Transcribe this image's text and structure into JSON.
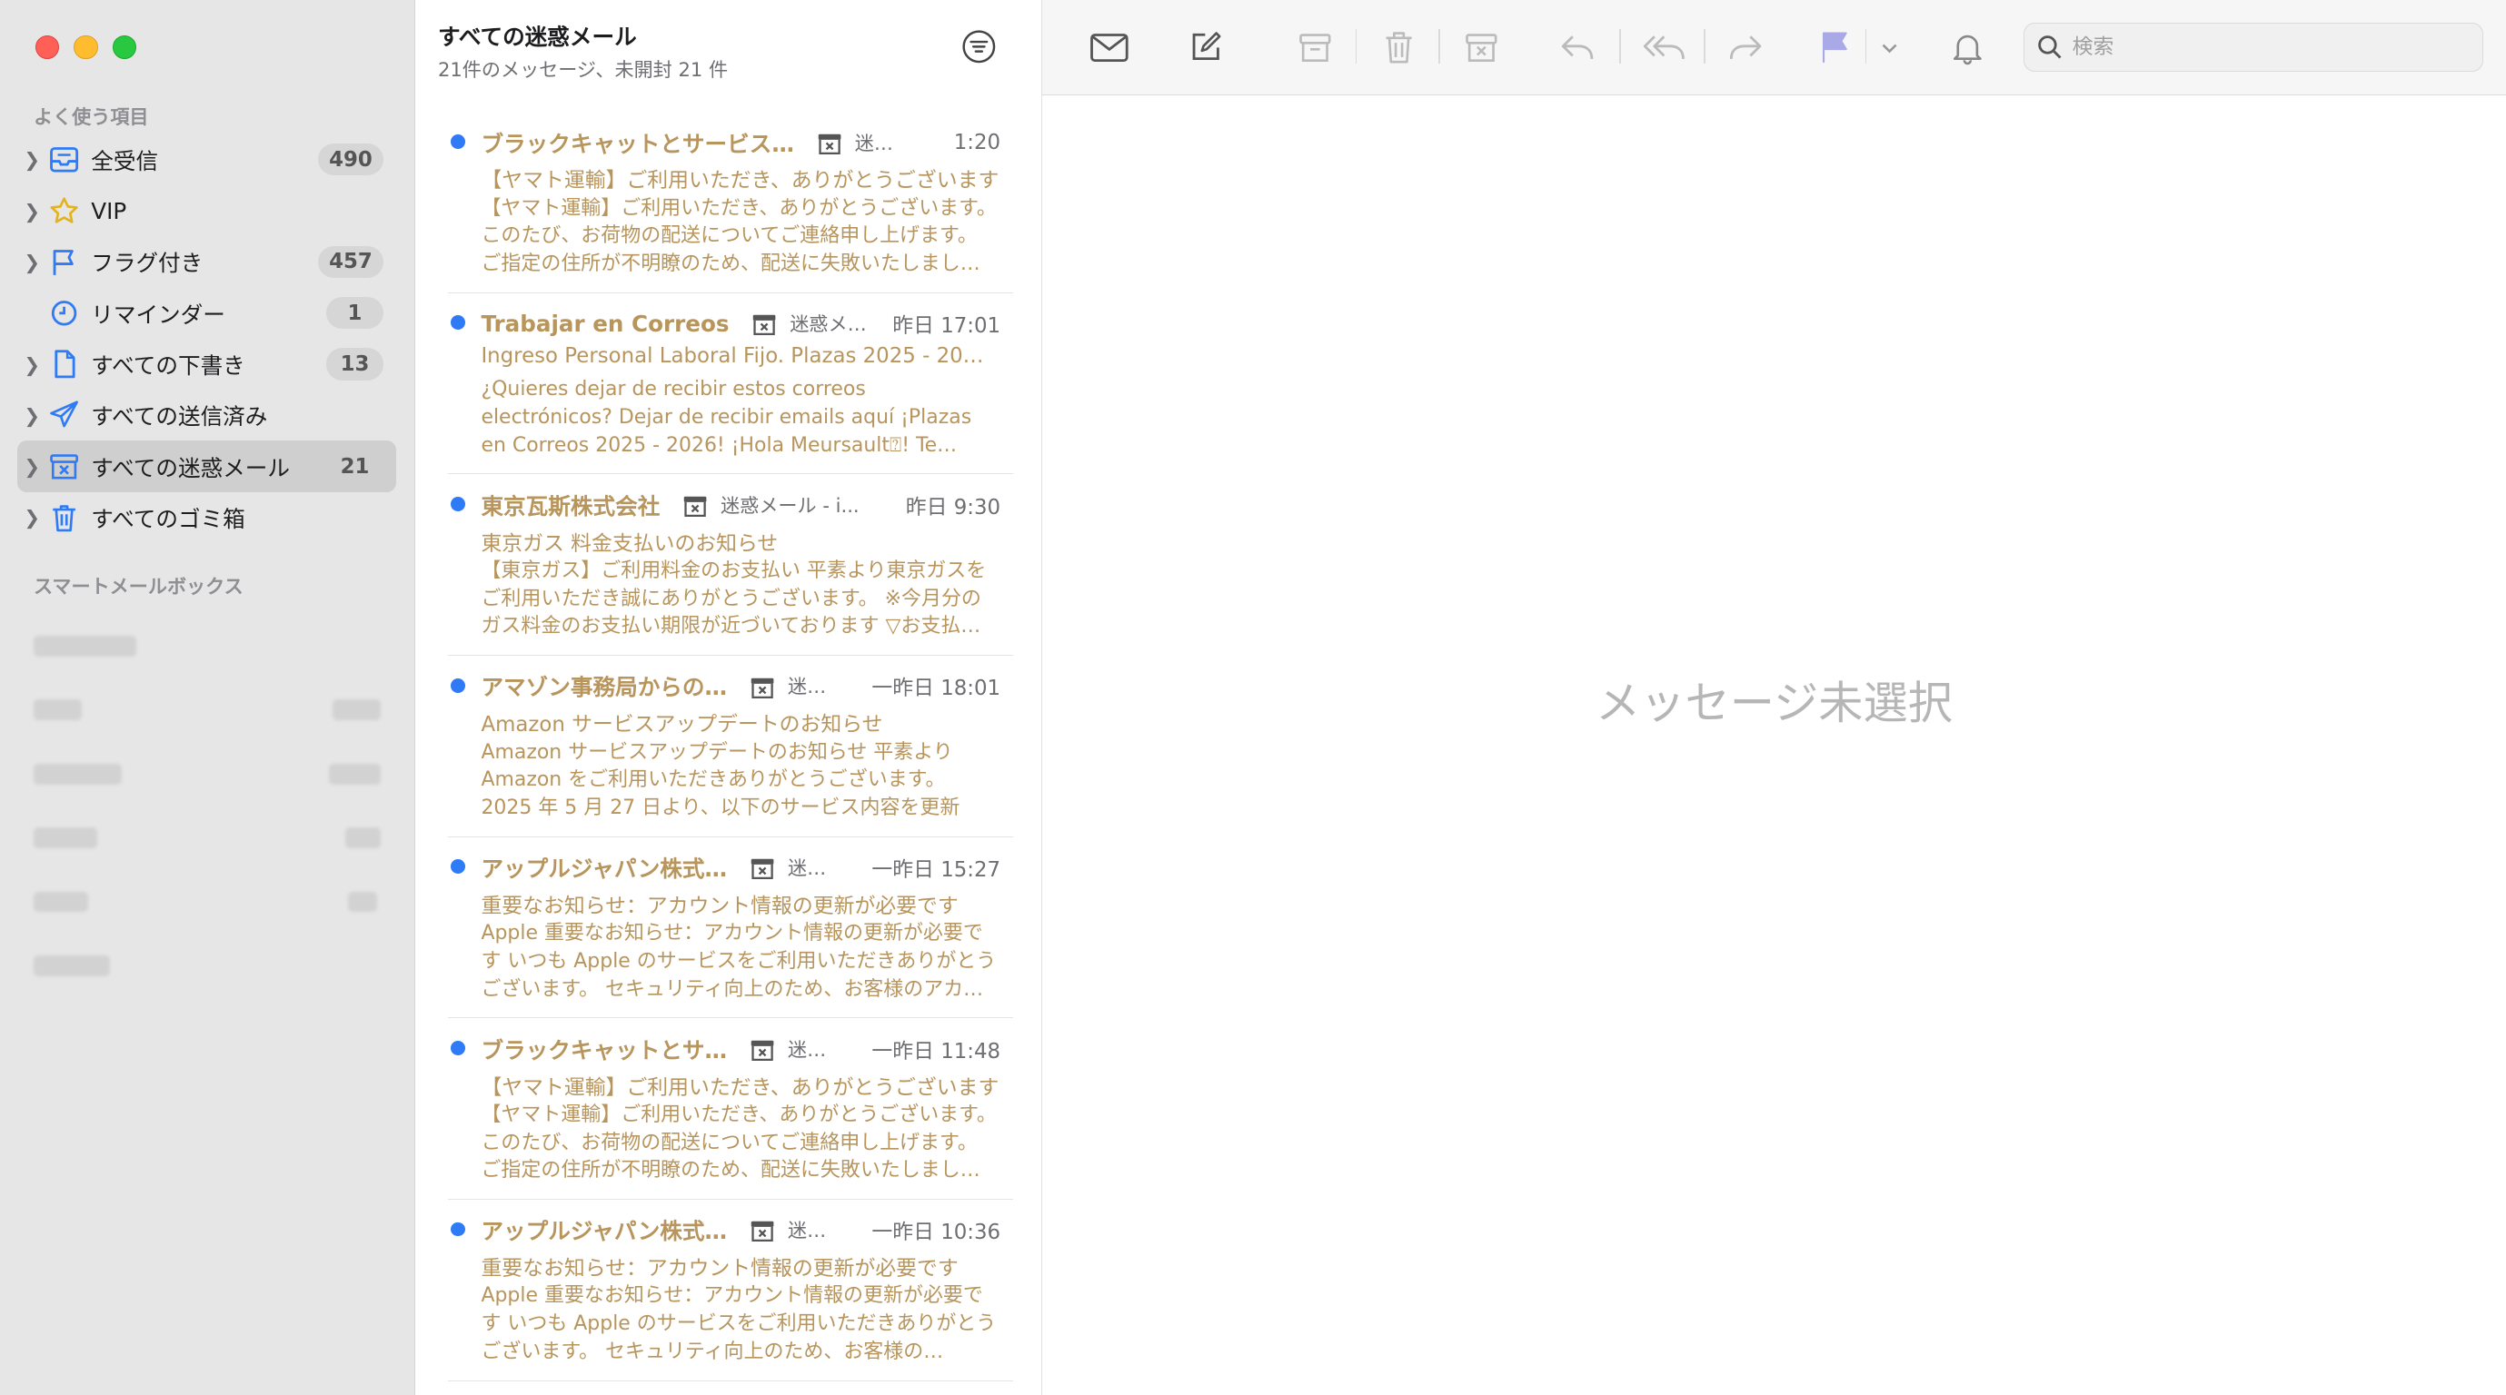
{
  "sidebar": {
    "favorites_title": "よく使う項目",
    "smart_title": "スマートメールボックス",
    "items": [
      {
        "label": "全受信",
        "count": "490"
      },
      {
        "label": "VIP",
        "count": ""
      },
      {
        "label": "フラグ付き",
        "count": "457"
      },
      {
        "label": "リマインダー",
        "count": "1"
      },
      {
        "label": "すべての下書き",
        "count": "13"
      },
      {
        "label": "すべての送信済み",
        "count": ""
      },
      {
        "label": "すべての迷惑メール",
        "count": "21"
      },
      {
        "label": "すべてのゴミ箱",
        "count": ""
      }
    ],
    "selected_index": 6
  },
  "message_list": {
    "title": "すべての迷惑メール",
    "subtitle": "21件のメッセージ、未開封 21 件",
    "messages": [
      {
        "sender": "ブラックキャットとサービス…",
        "mailbox": "迷…",
        "time": "1:20",
        "subject": "【ヤマト運輸】ご利用いただき、ありがとうございます",
        "preview": "【ヤマト運輸】ご利用いただき、ありがとうございます。このたび、お荷物の配送についてご連絡申し上げます。ご指定の住所が不明瞭のため、配送に失敗いたしまし…"
      },
      {
        "sender": "Trabajar en Correos",
        "mailbox": "迷惑メ…",
        "time": "昨日 17:01",
        "subject": "Ingreso Personal Laboral Fijo. Plazas 2025 - 20…",
        "preview": "¿Quieres dejar de recibir estos correos electrónicos? Dejar de recibir emails aquí ¡Plazas en Correos 2025 - 2026! ¡Hola Meursault⍰! Te…"
      },
      {
        "sender": "東京瓦斯株式会社",
        "mailbox": "迷惑メール - i...",
        "time": "昨日 9:30",
        "subject": "東京ガス 料金支払いのお知らせ",
        "preview": "【東京ガス】ご利用料金のお支払い 平素より東京ガスをご利用いただき誠にありがとうございます。 ※今月分のガス料金のお支払い期限が近づいております ▽お支払…"
      },
      {
        "sender": "アマゾン事務局からの…",
        "mailbox": "迷…",
        "time": "一昨日 18:01",
        "subject": "Amazon サービスアップデートのお知らせ",
        "preview": "Amazon サービスアップデートのお知らせ 平素より Amazon をご利用いただきありがとうございます。 2025 年 5 月 27 日より、以下のサービス内容を更新い…"
      },
      {
        "sender": "アップルジャパン株式…",
        "mailbox": "迷…",
        "time": "一昨日 15:27",
        "subject": "重要なお知らせ：アカウント情報の更新が必要です",
        "preview": "Apple 重要なお知らせ：アカウント情報の更新が必要です いつも Apple のサービスをご利用いただきありがとうございます。 セキュリティ向上のため、お客様のアカ…"
      },
      {
        "sender": "ブラックキャットとサ…",
        "mailbox": "迷…",
        "time": "一昨日 11:48",
        "subject": "【ヤマト運輸】ご利用いただき、ありがとうございます",
        "preview": "【ヤマト運輸】ご利用いただき、ありがとうございます。このたび、お荷物の配送についてご連絡申し上げます。ご指定の住所が不明瞭のため、配送に失敗いたしまし…"
      },
      {
        "sender": "アップルジャパン株式…",
        "mailbox": "迷…",
        "time": "一昨日 10:36",
        "subject": "重要なお知らせ：アカウント情報の更新が必要です",
        "preview": "Apple 重要なお知らせ：アカウント情報の更新が必要です いつも Apple のサービスをご利用いただきありがとうございます。 セキュリティ向上のため、お客様の…"
      }
    ]
  },
  "toolbar": {
    "icons": [
      "envelope-icon",
      "compose-icon",
      "archive-icon",
      "trash-icon",
      "junk-icon",
      "reply-icon",
      "reply-all-icon",
      "forward-icon",
      "flag-icon",
      "chevron-down-icon",
      "bell-icon"
    ],
    "search_placeholder": "検索"
  },
  "content": {
    "empty_text": "メッセージ未選択"
  },
  "colors": {
    "accent": "#2f7bf5",
    "sender_text": "#b8955c",
    "flag": "#a9a9e8"
  }
}
